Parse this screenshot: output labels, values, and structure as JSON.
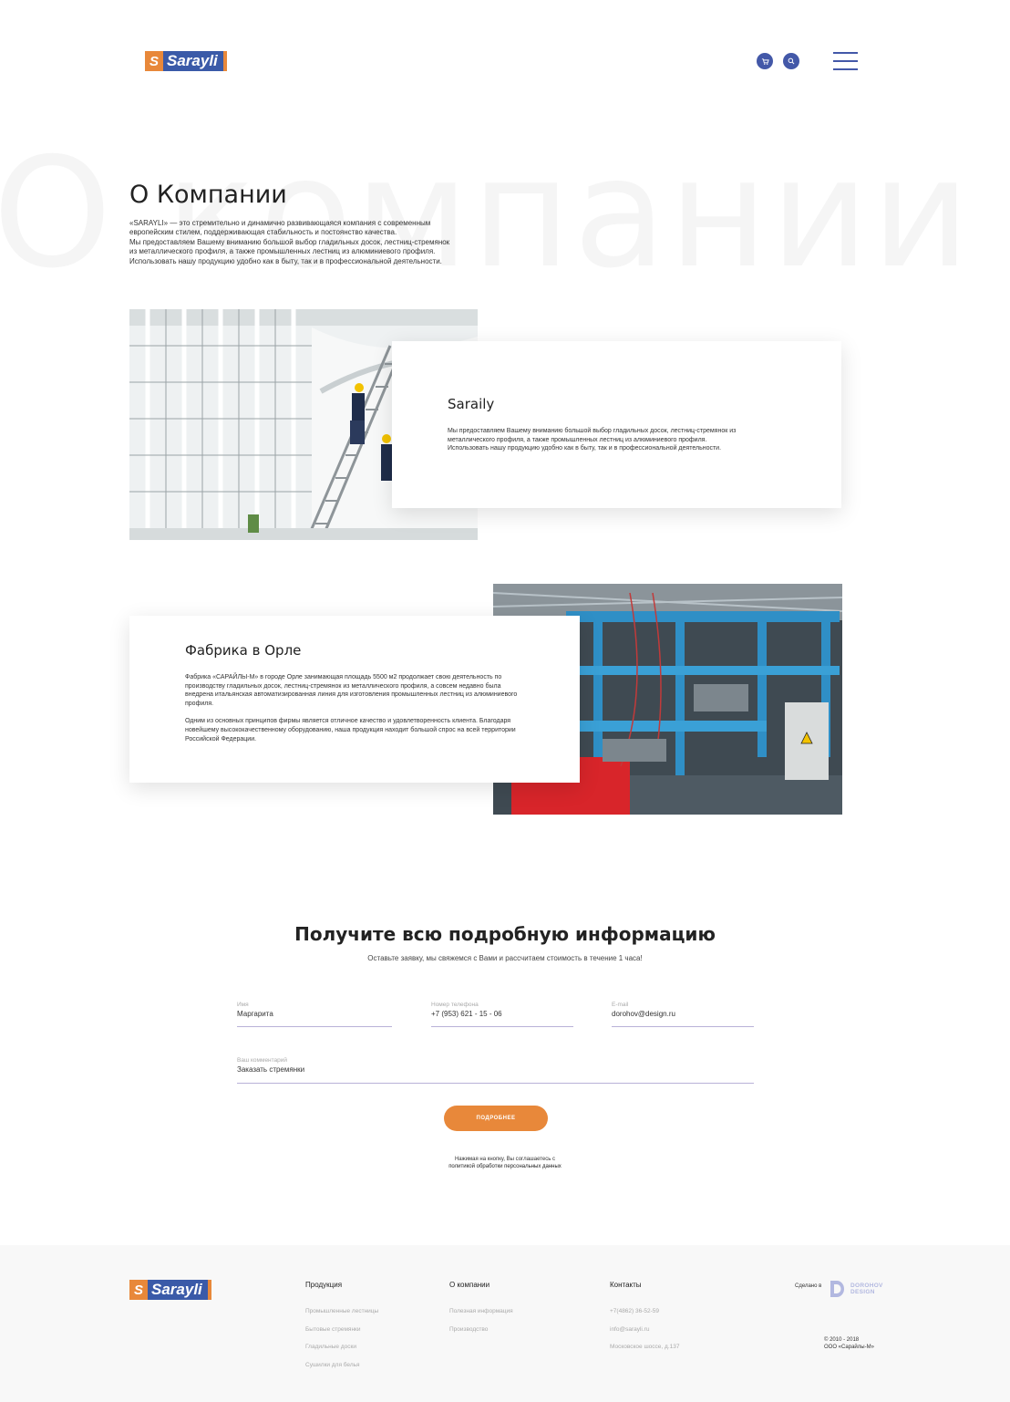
{
  "header": {
    "logo_text": "Sarayli",
    "logo_mark": "S",
    "icons": [
      "cart-icon",
      "search-icon",
      "menu-icon"
    ]
  },
  "about": {
    "background_word": "О компании",
    "title": "О Компании",
    "paragraphs": [
      "«SARAYLI» — это стремительно и динамично развивающаяся компания с современным европейским стилем, поддерживающая стабильность и постоянство качества.",
      "Мы предоставляем Вашему вниманию большой выбор гладильных досок, лестниц-стремянок из металлического профиля, а также промышленных лестниц из алюминиевого профиля.",
      "Использовать нашу продукцию удобно как в быту, так и в профессиональной деятельности."
    ]
  },
  "cards": [
    {
      "title": "Saraily",
      "paragraphs": [
        "Мы предоставляем Вашему вниманию большой выбор гладильных досок, лестниц-стремянок из металлического профиля, а также промышленных лестниц из алюминиевого профиля. Использовать нашу продукцию удобно как в быту, так и в профессиональной деятельности."
      ]
    },
    {
      "title": "Фабрика в Орле",
      "paragraphs": [
        "Фабрика «САРАЙЛЫ-М» в городе Орле занимающая площадь 5500 м2 продолжает свою деятельность по производству гладильных досок, лестниц-стремянок из металлического профиля, а совсем недавно была внедрена итальянская автоматизированная линия для изготовления промышленных лестниц из алюминиевого профиля.",
        "Одним из основных принципов фирмы является отличное качество и удовлетворенность клиента. Благодаря новейшему высококачественному оборудованию, наша продукция находит большой спрос на всей территории Российской Федерации."
      ]
    }
  ],
  "form": {
    "title": "Получите всю подробную информацию",
    "subtitle": "Оставьте заявку, мы свяжемся с Вами и рассчитаем стоимость в течение 1 часа!",
    "name_label": "Имя",
    "name_value": "Маргарита",
    "phone_label": "Номер телефона",
    "phone_value": "+7 (953) 621 - 15 - 06",
    "email_label": "E-mail",
    "email_value": "dorohov@design.ru",
    "comment_label": "Ваш комментарий",
    "comment_value": "Заказать стремянки",
    "submit_label": "ПОДРОБНЕЕ",
    "consent_line1": "Нажимая на кнопку, Вы соглашаетесь с",
    "consent_link": "политикой обработки персональных данных"
  },
  "footer": {
    "logo_text": "Sarayli",
    "columns": [
      {
        "head": "Продукция",
        "links": [
          "Промышленные лестницы",
          "Бытовые стремянки",
          "Гладильные доски",
          "Сушилки для белья"
        ]
      },
      {
        "head": "О компании",
        "links": [
          "Полезная информация",
          "Производство"
        ]
      },
      {
        "head": "Контакты",
        "links": [
          "+7(4862) 36-52-59",
          "info@sarayli.ru",
          "Московское шоссе, д.137"
        ]
      }
    ],
    "made_in": "Сделано в",
    "studio_line1": "DOROHOV",
    "studio_line2": "DESIGN",
    "copyright_line1": "© 2010 - 2018",
    "copyright_line2": "ООО «Сарайлы-М»"
  },
  "colors": {
    "accent": "#e8883a",
    "brand_blue": "#4358a8",
    "footer_bg": "#f8f8f8"
  }
}
